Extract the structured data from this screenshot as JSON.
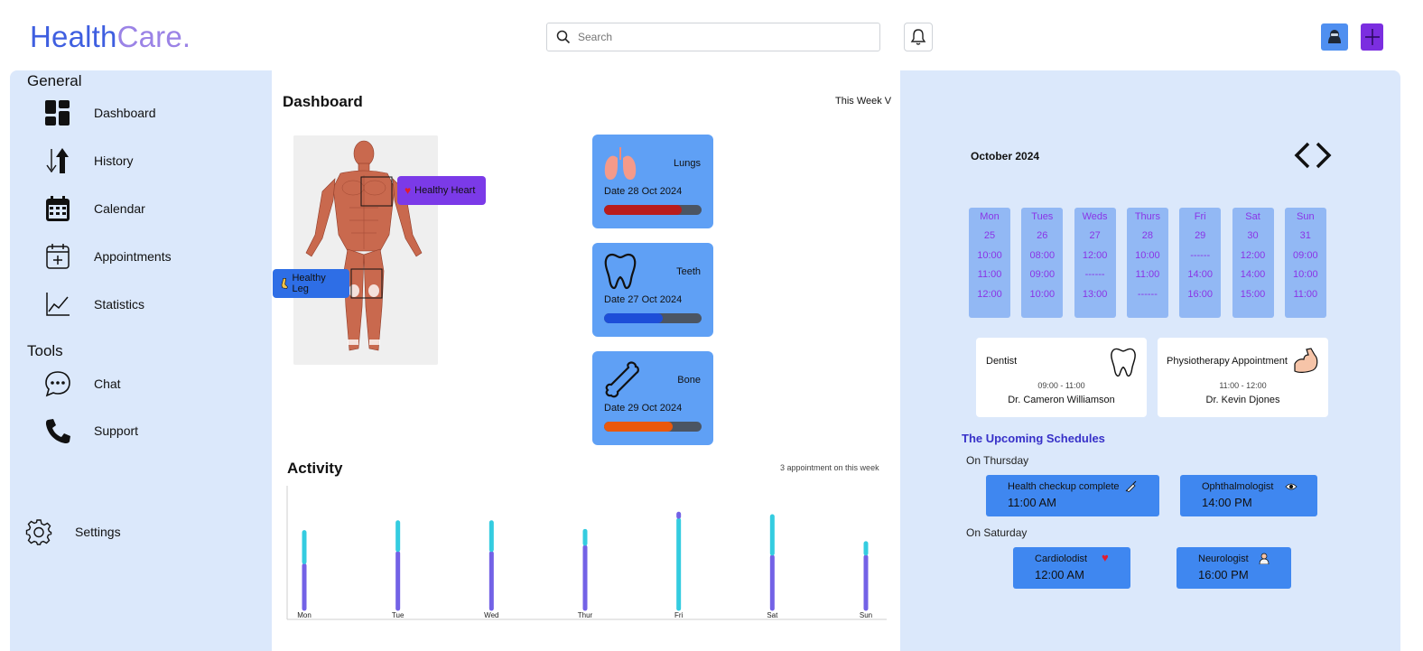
{
  "header": {
    "logo_part1": "Health",
    "logo_part2": "Care.",
    "search_placeholder": "Search"
  },
  "sidebar": {
    "general_title": "General",
    "items": [
      {
        "label": "Dashboard",
        "icon": "dashboard-icon"
      },
      {
        "label": "History",
        "icon": "history-arrows-icon"
      },
      {
        "label": "Calendar",
        "icon": "calendar-icon"
      },
      {
        "label": "Appointments",
        "icon": "calendar-plus-icon"
      },
      {
        "label": "Statistics",
        "icon": "chart-line-icon"
      }
    ],
    "tools_title": "Tools",
    "tools": [
      {
        "label": "Chat",
        "icon": "chat-icon"
      },
      {
        "label": "Support",
        "icon": "phone-icon"
      }
    ],
    "settings_label": "Settings"
  },
  "dashboard": {
    "title": "Dashboard",
    "period": "This Week V",
    "tag_heart": "Healthy Heart",
    "tag_leg": "Healthy Leg",
    "cards": [
      {
        "name": "Lungs",
        "date": "Date 28 Oct 2024",
        "progress": 0.8,
        "color": "#b91c1c",
        "icon": "lungs-icon"
      },
      {
        "name": "Teeth",
        "date": "Date 27 Oct 2024",
        "progress": 0.6,
        "color": "#1d4ed8",
        "icon": "tooth-icon"
      },
      {
        "name": "Bone",
        "date": "Date 29 Oct 2024",
        "progress": 0.7,
        "color": "#ea580c",
        "icon": "bone-icon"
      }
    ]
  },
  "activity": {
    "title": "Activity",
    "note": "3 appointment on this week"
  },
  "chart_data": {
    "type": "bar",
    "categories": [
      "Mon",
      "Tue",
      "Wed",
      "Thur",
      "Fri",
      "Sat",
      "Sun"
    ],
    "series": [
      {
        "values": [
          0.35,
          0.45,
          0.45,
          0.5,
          0.77,
          0.42,
          0.42
        ],
        "color": "#7362e6"
      },
      {
        "values": [
          0.62,
          0.7,
          0.7,
          0.63,
          0.72,
          0.75,
          0.53
        ],
        "color": "#34cce0"
      }
    ]
  },
  "calendar": {
    "month": "October 2024",
    "days": [
      {
        "name": "Mon",
        "date": "25",
        "times": [
          "10:00",
          "11:00",
          "12:00"
        ]
      },
      {
        "name": "Tues",
        "date": "26",
        "times": [
          "08:00",
          "09:00",
          "10:00"
        ]
      },
      {
        "name": "Weds",
        "date": "27",
        "times": [
          "12:00",
          "------",
          "13:00"
        ]
      },
      {
        "name": "Thurs",
        "date": "28",
        "times": [
          "10:00",
          "11:00",
          "------"
        ]
      },
      {
        "name": "Fri",
        "date": "29",
        "times": [
          "------",
          "14:00",
          "16:00"
        ]
      },
      {
        "name": "Sat",
        "date": "30",
        "times": [
          "12:00",
          "14:00",
          "15:00"
        ]
      },
      {
        "name": "Sun",
        "date": "31",
        "times": [
          "09:00",
          "10:00",
          "11:00"
        ]
      }
    ]
  },
  "appointments": [
    {
      "title": "Dentist",
      "time": "09:00 - 11:00",
      "doctor": "Dr. Cameron Williamson",
      "icon": "tooth-icon"
    },
    {
      "title": "Physiotherapy Appointment",
      "time": "11:00 - 12:00",
      "doctor": "Dr. Kevin Djones",
      "icon": "muscle-arm-icon"
    }
  ],
  "upcoming": {
    "title": "The Upcoming Schedules",
    "thursday_label": "On Thursday",
    "saturday_label": "On Saturday",
    "thursday": [
      {
        "name": "Health checkup complete",
        "time": "11:00 AM",
        "icon": "syringe-icon"
      },
      {
        "name": "Ophthalmologist",
        "time": "14:00 PM",
        "icon": "eye-icon"
      }
    ],
    "saturday": [
      {
        "name": "Cardiolodist",
        "time": "12:00 AM",
        "icon": "heart-icon"
      },
      {
        "name": "Neurologist",
        "time": "16:00 PM",
        "icon": "doctor-icon"
      }
    ]
  }
}
